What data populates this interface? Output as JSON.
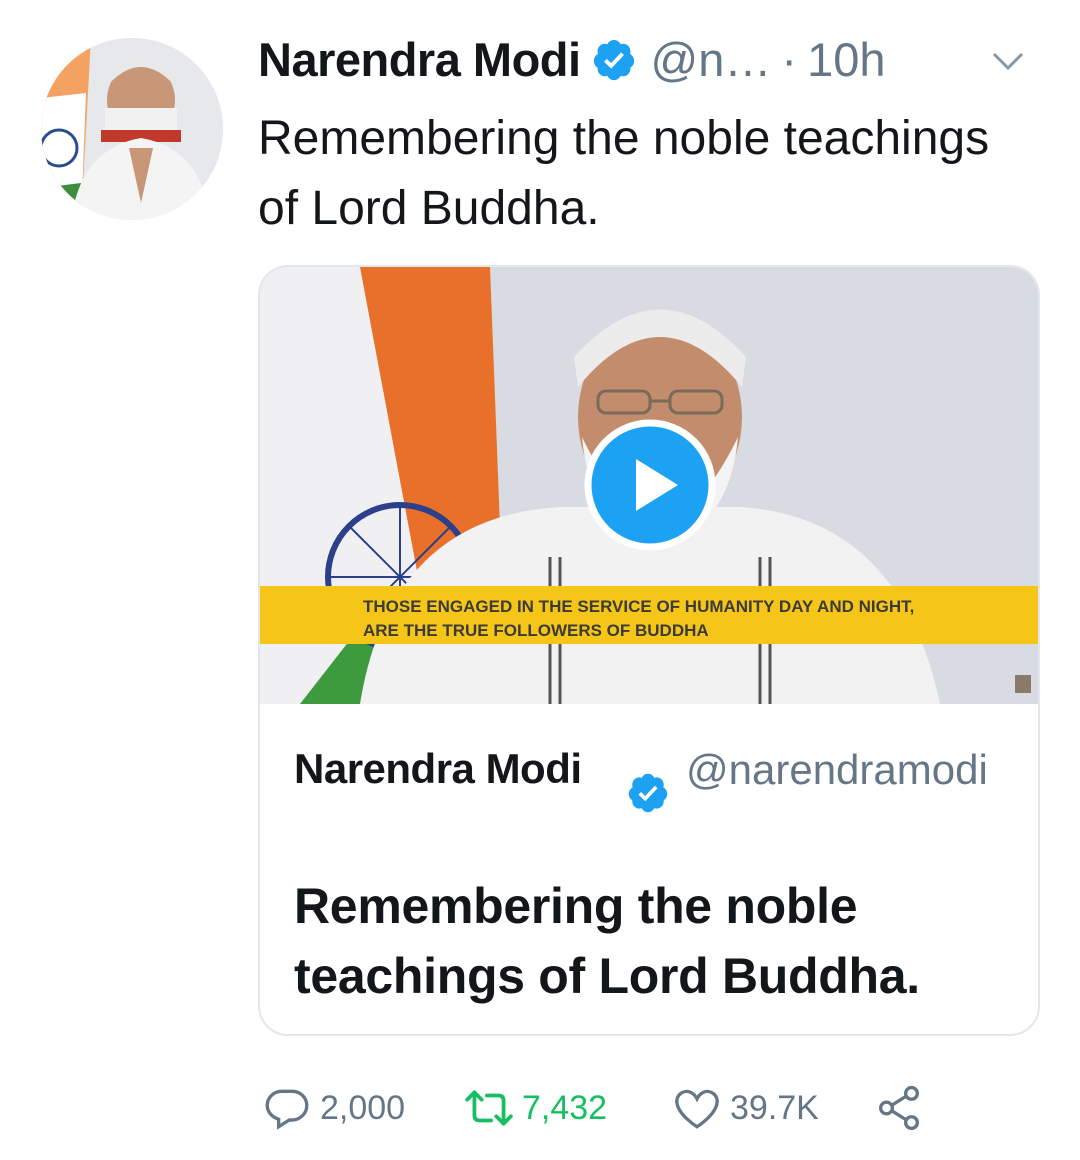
{
  "tweet": {
    "author_name": "Narendra Modi",
    "handle": "@n…",
    "separator": "·",
    "time": "10h",
    "text": "Remembering the noble teachings of Lord Buddha."
  },
  "media": {
    "caption": "THOSE ENGAGED IN THE SERVICE OF HUMANITY DAY AND NIGHT, ARE THE TRUE FOLLOWERS OF BUDDHA"
  },
  "quoted": {
    "author_name": "Narendra Modi",
    "handle": "@narendramodi",
    "text": "Remembering the noble teachings of Lord Buddha."
  },
  "actions": {
    "replies": "2,000",
    "retweets": "7,432",
    "likes": "39.7K"
  },
  "colors": {
    "verified_blue": "#1da1f2",
    "retweet_green": "#17bf63",
    "muted_gray": "#657786",
    "banner_yellow": "#f5c518"
  },
  "icons": [
    "verified-badge-icon",
    "chevron-down-icon",
    "play-icon",
    "reply-icon",
    "retweet-icon",
    "like-icon",
    "share-icon"
  ]
}
